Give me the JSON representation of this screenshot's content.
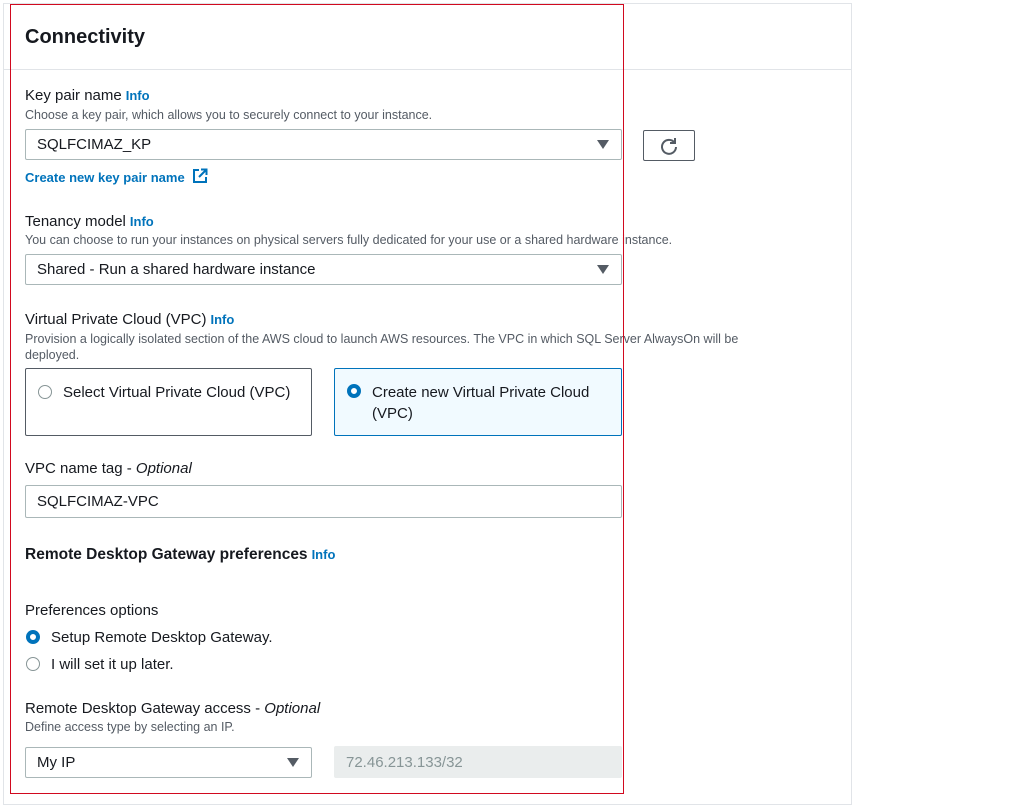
{
  "section": {
    "title": "Connectivity"
  },
  "info_label": "Info",
  "key_pair": {
    "label": "Key pair name",
    "description": "Choose a key pair, which allows you to securely connect to your instance.",
    "selected": "SQLFCIMAZ_KP",
    "create_link": "Create new key pair name"
  },
  "tenancy": {
    "label": "Tenancy model",
    "description": "You can choose to run your instances on physical servers fully dedicated for your use or a shared hardware instance.",
    "selected": "Shared - Run a shared hardware instance"
  },
  "vpc": {
    "label": "Virtual Private Cloud (VPC)",
    "description": "Provision a logically isolated section of the AWS cloud to launch AWS resources. The VPC in which SQL Server AlwaysOn will be deployed.",
    "options": [
      {
        "label": "Select Virtual Private Cloud (VPC)",
        "selected": false
      },
      {
        "label": "Create new Virtual Private Cloud (VPC)",
        "selected": true
      }
    ]
  },
  "vpc_name_tag": {
    "label": "VPC name tag",
    "optional": "Optional",
    "value": "SQLFCIMAZ-VPC"
  },
  "rdg": {
    "title": "Remote Desktop Gateway preferences",
    "preferences_label": "Preferences options",
    "options": [
      {
        "label": "Setup Remote Desktop Gateway.",
        "selected": true
      },
      {
        "label": "I will set it up later.",
        "selected": false
      }
    ],
    "access_label": "Remote Desktop Gateway access",
    "access_optional": "Optional",
    "access_description": "Define access type by selecting an IP.",
    "access_type": "My IP",
    "ip_value": "72.46.213.133/32"
  },
  "colors": {
    "accent": "#0073bb",
    "highlight_border": "#d1091f",
    "selected_tile_bg": "#f1faff"
  },
  "icons": {
    "refresh": "refresh-icon",
    "external_link": "external-link-icon",
    "dropdown": "caret-down-icon"
  }
}
